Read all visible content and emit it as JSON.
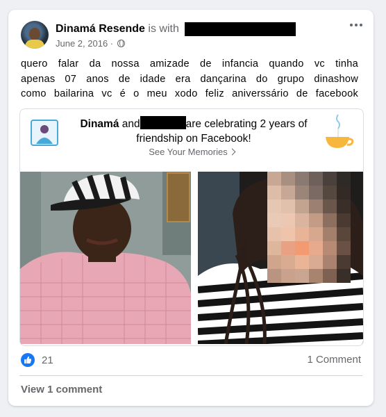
{
  "post": {
    "author": "Dinamá Resende",
    "with_text": "is with",
    "date": "June 2, 2016 ·",
    "privacy_icon": "globe-icon",
    "more_icon": "more-options-icon",
    "text_lines": [
      "quero falar da nossa amizade de infancia quando vc tinha",
      "apenas 07 anos de idade era dançarina do grupo dinashow",
      "como bailarina vc é o meu xodo feliz aniverssário de facebook"
    ]
  },
  "memory": {
    "name": "Dinamá",
    "and_text": "and",
    "celebrating_text": "are celebrating 2 years of friendship on Facebook!",
    "see_memories": "See Your Memories",
    "left_icon": "friend-photo-icon",
    "right_icon": "teacup-icon"
  },
  "footer": {
    "like_count": "21",
    "comments": "1 Comment",
    "view_comments": "View 1 comment",
    "like_icon": "thumbs-up-icon",
    "accent": "#1877f2"
  }
}
